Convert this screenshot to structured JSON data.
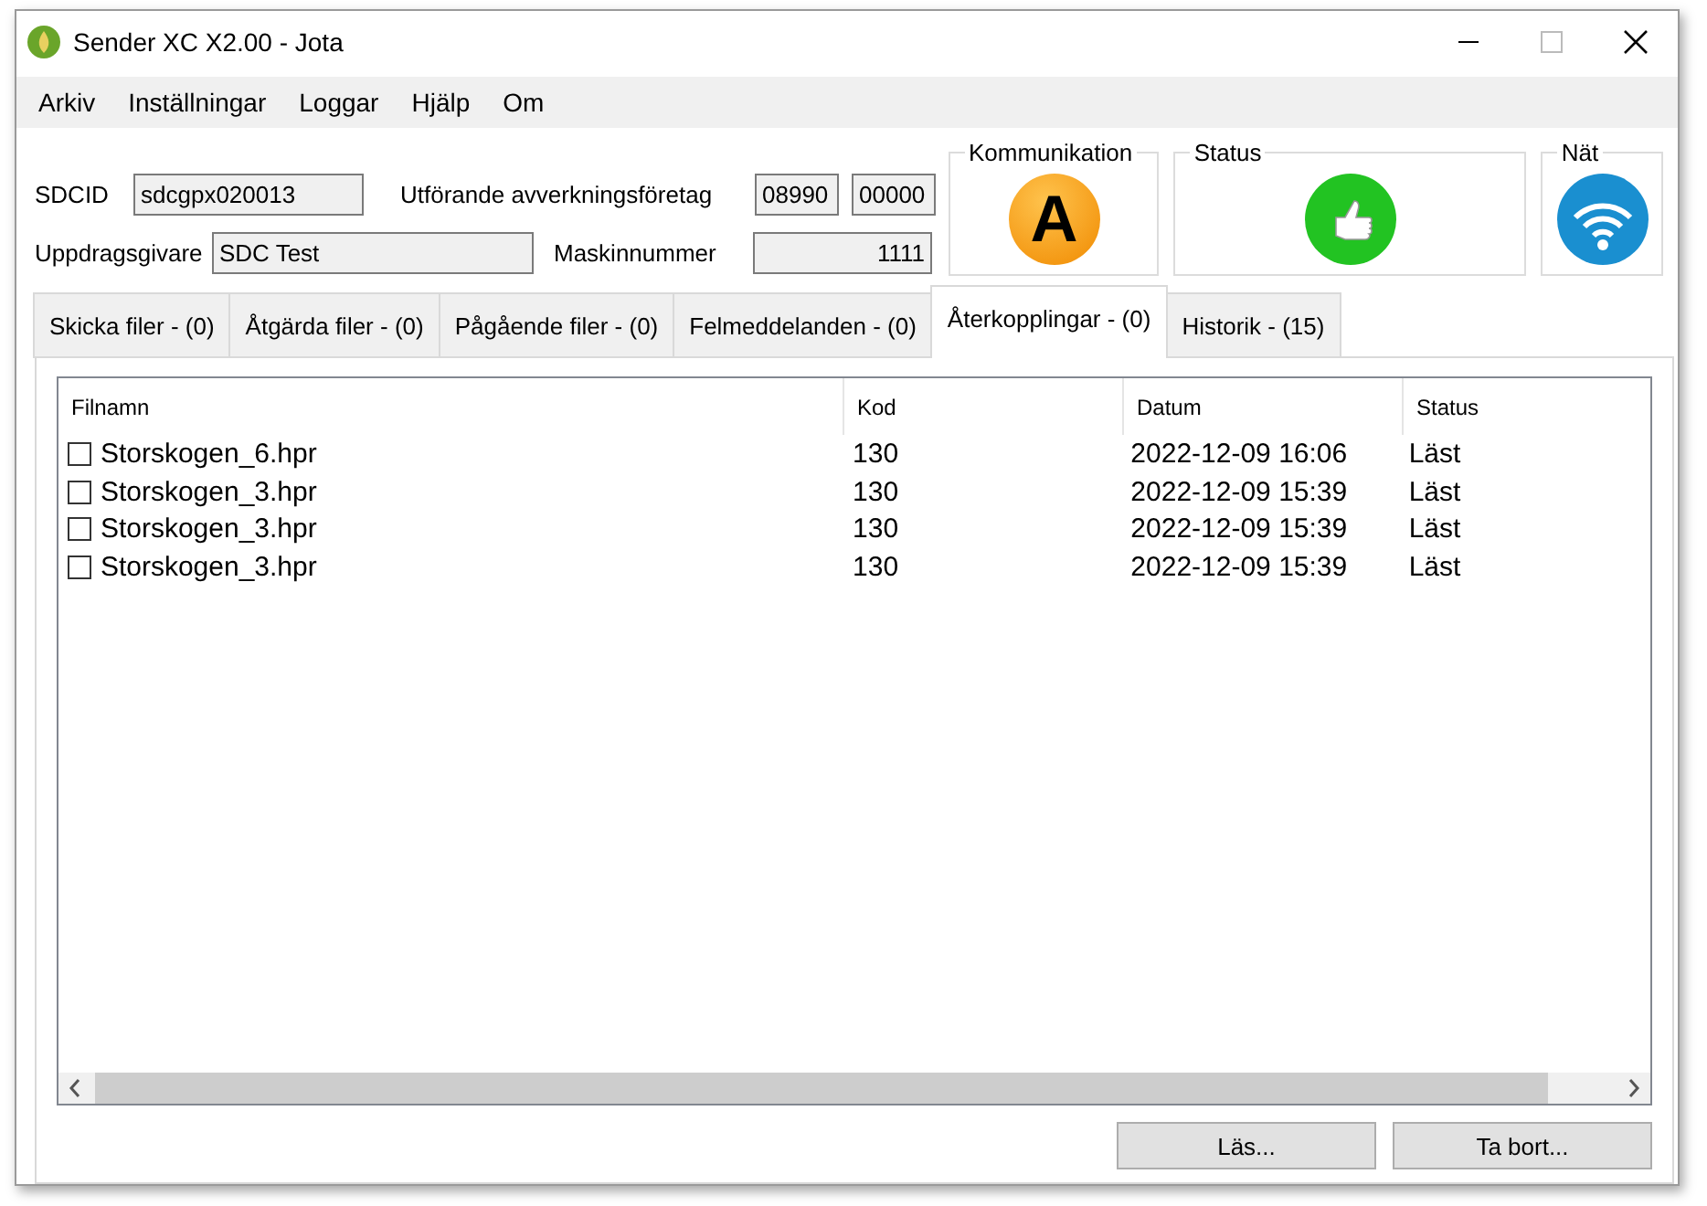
{
  "window": {
    "title": "Sender XC X2.00 - Jota"
  },
  "menu": [
    "Arkiv",
    "Inställningar",
    "Loggar",
    "Hjälp",
    "Om"
  ],
  "form": {
    "sdcid_label": "SDCID",
    "sdcid": "sdcgpx020013",
    "company_label": "Utförande avverkningsföretag",
    "company_1": "08990",
    "company_2": "00000",
    "client_label": "Uppdragsgivare",
    "client": "SDC Test",
    "machine_label": "Maskinnummer",
    "machine": "1111"
  },
  "indicators": [
    {
      "title": "Kommunikation",
      "kind": "letter",
      "letter": "A"
    },
    {
      "title": "Status",
      "kind": "thumbs-up"
    },
    {
      "title": "Nät",
      "kind": "signal"
    }
  ],
  "tabs": [
    {
      "label": "Skicka filer - (0)",
      "selected": false
    },
    {
      "label": "Åtgärda filer - (0)",
      "selected": false
    },
    {
      "label": "Pågående filer - (0)",
      "selected": false
    },
    {
      "label": "Felmeddelanden - (0)",
      "selected": false
    },
    {
      "label": "Återkopplingar - (0)",
      "selected": true
    },
    {
      "label": "Historik - (15)",
      "selected": false
    }
  ],
  "table": {
    "columns": [
      "Filnamn",
      "Kod",
      "Datum",
      "Status"
    ],
    "rows": [
      {
        "checked": false,
        "cells": [
          "Storskogen_6.hpr",
          "130",
          "2022-12-09 16:06",
          "Läst"
        ]
      },
      {
        "checked": false,
        "cells": [
          "Storskogen_3.hpr",
          "130",
          "2022-12-09 15:39",
          "Läst"
        ]
      },
      {
        "checked": false,
        "cells": [
          "Storskogen_3.hpr",
          "130",
          "2022-12-09 15:39",
          "Läst"
        ]
      },
      {
        "checked": false,
        "cells": [
          "Storskogen_3.hpr",
          "130",
          "2022-12-09 15:39",
          "Läst"
        ]
      }
    ]
  },
  "buttons": [
    "Läs...",
    "Ta bort..."
  ]
}
